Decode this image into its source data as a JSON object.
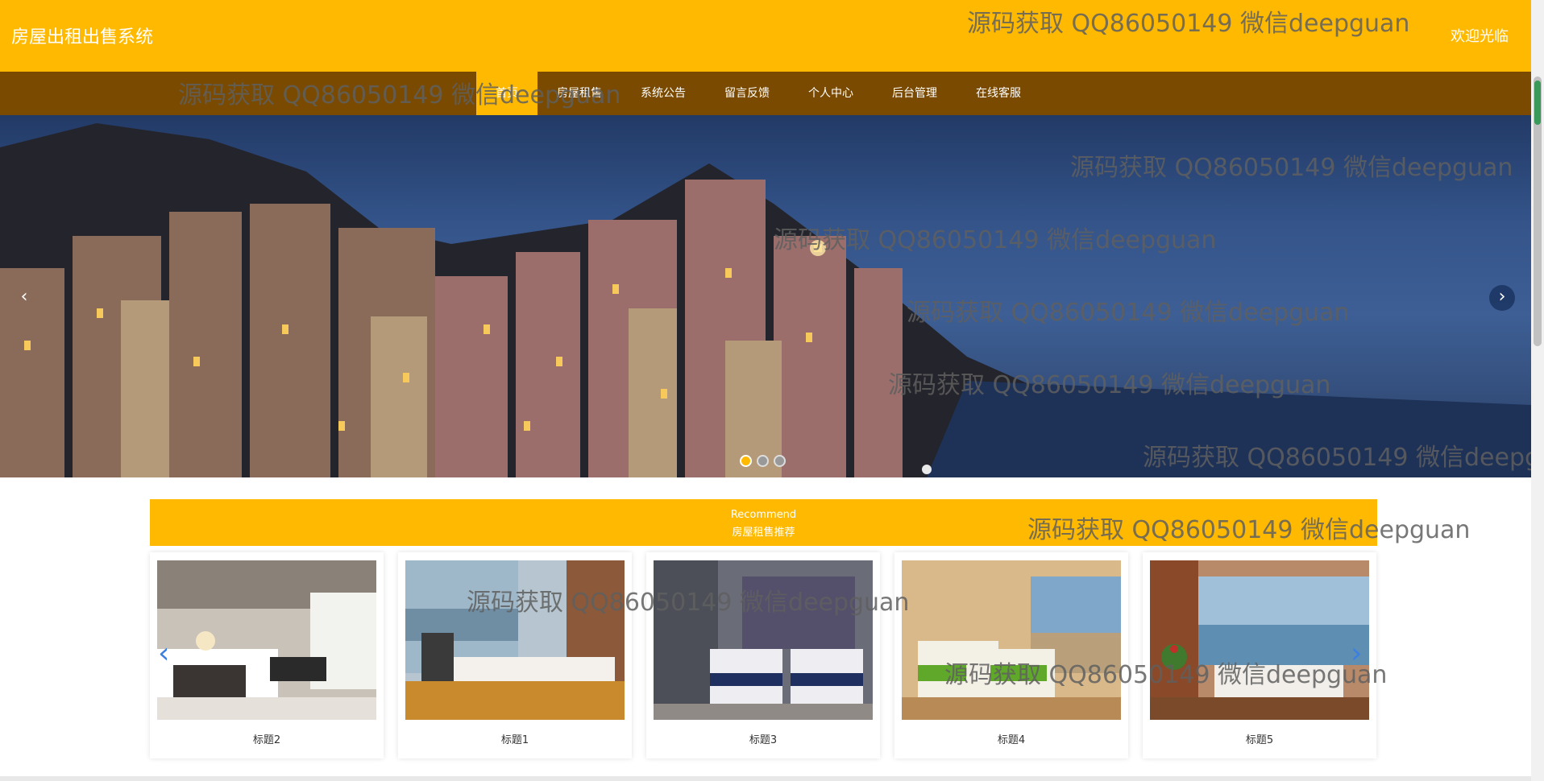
{
  "header": {
    "site_title": "房屋出租出售系统",
    "welcome": "欢迎光临"
  },
  "nav": {
    "items": [
      {
        "label": "首页"
      },
      {
        "label": "房屋租售"
      },
      {
        "label": "系统公告"
      },
      {
        "label": "留言反馈"
      },
      {
        "label": "个人中心"
      },
      {
        "label": "后台管理"
      },
      {
        "label": "在线客服"
      }
    ]
  },
  "banner": {
    "prev_icon": "chevron-left-icon",
    "next_icon": "chevron-right-icon",
    "prev_glyph": "‹",
    "next_glyph": "›",
    "slide_count": 3,
    "active_slide": 1
  },
  "recommend": {
    "title_en": "Recommend",
    "title_cn": "房屋租售推荐"
  },
  "cards": [
    {
      "caption": "标题2"
    },
    {
      "caption": "标题1"
    },
    {
      "caption": "标题3"
    },
    {
      "caption": "标题4"
    },
    {
      "caption": "标题5"
    }
  ],
  "watermark": "源码获取 QQ86050149 微信deepguan",
  "colors": {
    "accent": "#FFB900",
    "nav_bg": "#7A4A00"
  }
}
